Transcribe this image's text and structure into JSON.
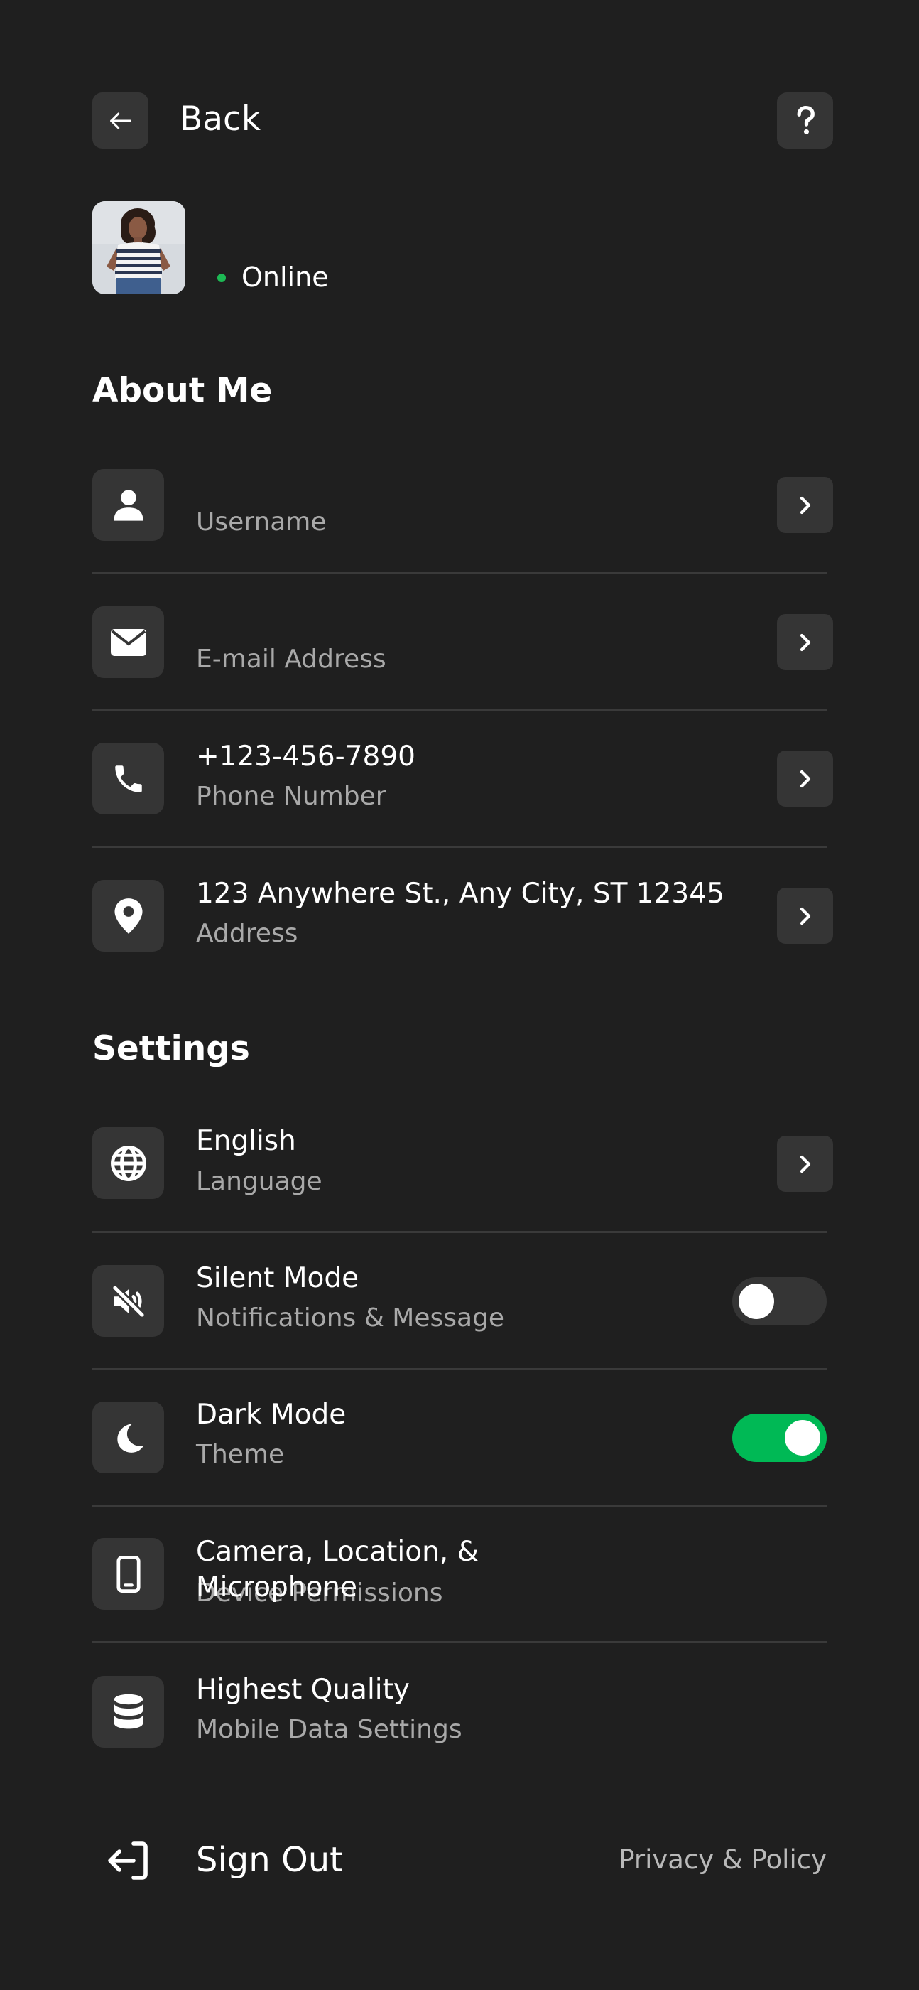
{
  "header": {
    "back_label": "Back"
  },
  "profile": {
    "status": "Online",
    "status_color": "#1db954"
  },
  "about": {
    "title": "About Me",
    "items": [
      {
        "icon": "user-icon",
        "value": "",
        "label": "Username"
      },
      {
        "icon": "mail-icon",
        "value": "",
        "label": "E-mail Address"
      },
      {
        "icon": "phone-icon",
        "value": "+123-456-7890",
        "label": "Phone Number"
      },
      {
        "icon": "location-pin-icon",
        "value": "123 Anywhere St., Any City, ST 12345",
        "label": "Address"
      }
    ]
  },
  "settings": {
    "title": "Settings",
    "items": [
      {
        "icon": "globe-icon",
        "value": "English",
        "label": "Language",
        "control": "chevron"
      },
      {
        "icon": "speaker-mute-icon",
        "value": "Silent Mode",
        "label": "Notifications & Message",
        "control": "toggle",
        "on": false
      },
      {
        "icon": "moon-icon",
        "value": "Dark Mode",
        "label": "Theme",
        "control": "toggle",
        "on": true
      },
      {
        "icon": "mobile-device-icon",
        "value": "Camera, Location, & Microphone",
        "label": "Device Permissions",
        "control": "none"
      },
      {
        "icon": "database-icon",
        "value": "Highest Quality",
        "label": "Mobile Data Settings",
        "control": "none"
      }
    ]
  },
  "footer": {
    "sign_out": "Sign Out",
    "privacy": "Privacy & Policy"
  },
  "colors": {
    "background": "#1f1f1f",
    "tile": "#353535",
    "accent_green": "#00b955"
  }
}
